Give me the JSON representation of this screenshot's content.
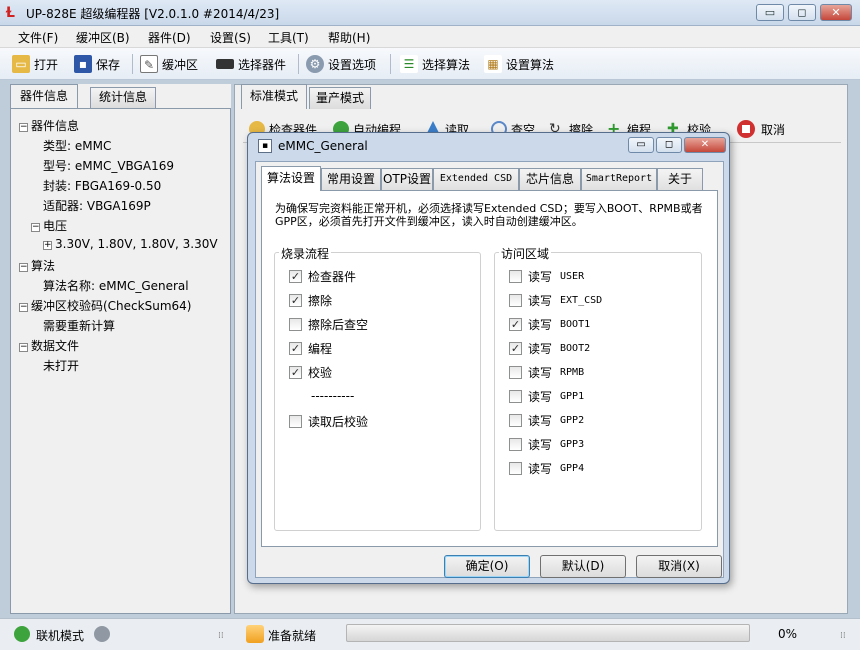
{
  "app": {
    "title": "UP-828E 超级编程器  [V2.0.1.0 #2014/4/23]"
  },
  "window_controls": {
    "minimize": "▭",
    "maximize": "◻",
    "close": "✕"
  },
  "menu": [
    "文件(F)",
    "缓冲区(B)",
    "器件(D)",
    "设置(S)",
    "工具(T)",
    "帮助(H)"
  ],
  "toolbar": {
    "open": "打开",
    "save": "保存",
    "buffer": "缓冲区",
    "select_device": "选择器件",
    "settings": "设置选项",
    "select_algorithm": "选择算法",
    "setup_algorithm": "设置算法"
  },
  "left_tabs": [
    "器件信息",
    "统计信息"
  ],
  "tree": {
    "device_info": "器件信息",
    "type": "类型: eMMC",
    "model": "型号: eMMC_VBGA169",
    "package": "封装: FBGA169-0.50",
    "adapter": "适配器: VBGA169P",
    "voltage": "电压",
    "voltage_values": "3.30V, 1.80V, 1.80V, 3.30V",
    "algorithm": "算法",
    "algorithm_name": "算法名称: eMMC_General",
    "checksum": "缓冲区校验码(CheckSum64)",
    "checksum_value": "需要重新计算",
    "data_file": "数据文件",
    "data_file_value": "未打开"
  },
  "right_tabs": [
    "标准模式",
    "量产模式"
  ],
  "sub_toolbar": {
    "check": "检查器件",
    "auto": "自动编程",
    "read": "读取",
    "blank": "查空",
    "erase": "擦除",
    "program": "编程",
    "verify": "校验",
    "cancel": "取消"
  },
  "dialog": {
    "title": "eMMC_General",
    "tabs": [
      "算法设置",
      "常用设置",
      "OTP设置",
      "Extended CSD",
      "芯片信息",
      "SmartReport",
      "关于"
    ],
    "notice": "为确保写完资料能正常开机，必须选择读写Extended CSD；要写入BOOT、RPMB或者GPP区，必须首先打开文件到缓冲区，读入时自动创建缓冲区。",
    "flow_title": "烧录流程",
    "flow": [
      {
        "label": "检查器件",
        "checked": true
      },
      {
        "label": "擦除",
        "checked": true
      },
      {
        "label": "擦除后查空",
        "checked": false
      },
      {
        "label": "编程",
        "checked": true
      },
      {
        "label": "校验",
        "checked": true
      }
    ],
    "flow_separator": "----------",
    "flow_extra": {
      "label": "读取后校验",
      "checked": false
    },
    "area_title": "访问区域",
    "areas": [
      {
        "prefix": "读写",
        "name": "USER",
        "checked": false
      },
      {
        "prefix": "读写",
        "name": "EXT_CSD",
        "checked": false
      },
      {
        "prefix": "读写",
        "name": "BOOT1",
        "checked": true
      },
      {
        "prefix": "读写",
        "name": "BOOT2",
        "checked": true
      },
      {
        "prefix": "读写",
        "name": "RPMB",
        "checked": false
      },
      {
        "prefix": "读写",
        "name": "GPP1",
        "checked": false
      },
      {
        "prefix": "读写",
        "name": "GPP2",
        "checked": false
      },
      {
        "prefix": "读写",
        "name": "GPP3",
        "checked": false
      },
      {
        "prefix": "读写",
        "name": "GPP4",
        "checked": false
      }
    ],
    "ok": "确定(O)",
    "default": "默认(D)",
    "cancel": "取消(X)"
  },
  "status": {
    "mode": "联机模式",
    "ready": "准备就绪",
    "progress": 0,
    "progress_text": "0%"
  },
  "colors": {
    "accent": "#3c7fb1",
    "close": "#c4473a",
    "check": "#2a2a2a"
  }
}
